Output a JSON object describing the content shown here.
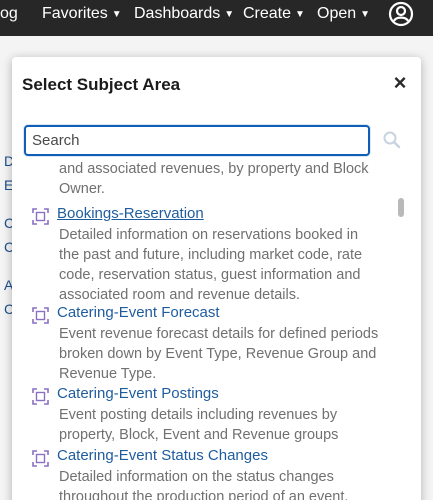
{
  "topbar": {
    "partial_label": "og",
    "favorites_label": "Favorites",
    "dashboards_label": "Dashboards",
    "create_label": "Create",
    "open_label": "Open"
  },
  "background": {
    "letters": [
      "D",
      "E",
      "C",
      "C",
      "A",
      "C"
    ]
  },
  "dialog": {
    "title": "Select Subject Area",
    "close_label": "×",
    "search": {
      "placeholder": "Search",
      "value": ""
    }
  },
  "list": {
    "top_description": "and associated revenues, by property and Block Owner.",
    "items": [
      {
        "title": "Bookings-Reservation",
        "description": "Detailed information on reservations booked in the past and future, including market code, rate code, reservation status, guest information and associated room and revenue details."
      },
      {
        "title": "Catering-Event Forecast",
        "description": "Event revenue forecast details for defined periods broken down by Event Type, Revenue Group and Revenue Type."
      },
      {
        "title": "Catering-Event Postings",
        "description": "Event posting details including revenues by property, Block, Event and Revenue groups"
      },
      {
        "title": "Catering-Event Status Changes",
        "description": "Detailed information on the status changes throughout the production period of an event,"
      }
    ]
  },
  "colors": {
    "topbar": "#272727",
    "link": "#1f5c9e",
    "description": "#707070",
    "focus_border": "#0e5fb5",
    "icon": "#8a6fc4"
  }
}
